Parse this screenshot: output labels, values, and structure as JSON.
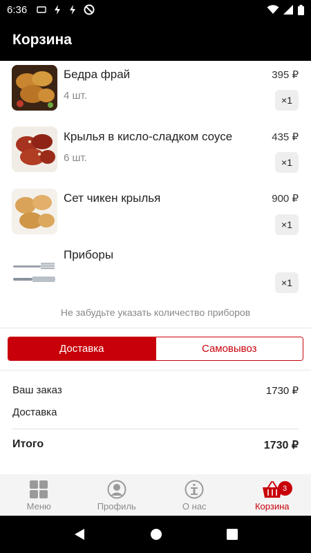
{
  "status_bar": {
    "time": "6:36",
    "notif_icons": [
      "app-icon",
      "bolt-icon",
      "bolt-icon",
      "no-disturb-icon"
    ],
    "right_icons": [
      "wifi-icon",
      "signal-icon",
      "battery-icon"
    ]
  },
  "header": {
    "title": "Корзина"
  },
  "cart": {
    "items": [
      {
        "name": "Бедра фрай",
        "qty": "4 шт.",
        "price": "395 ₽",
        "multiplier": "×1",
        "image": "fried-thighs-photo"
      },
      {
        "name": "Крылья в кисло-сладком соусе",
        "qty": "6 шт.",
        "price": "435 ₽",
        "multiplier": "×1",
        "image": "sweet-sour-wings-photo"
      },
      {
        "name": "Сет чикен крылья",
        "qty": "",
        "price": "900 ₽",
        "multiplier": "×1",
        "image": "chicken-wings-set-photo"
      },
      {
        "name": "Приборы",
        "qty": "",
        "price": "",
        "multiplier": "×1",
        "image": "cutlery-photo"
      }
    ],
    "reminder": "Не забудьте указать количество приборов"
  },
  "delivery_toggle": {
    "options": [
      "Доставка",
      "Самовывоз"
    ],
    "selected": "Доставка"
  },
  "summary": {
    "order_label": "Ваш заказ",
    "order_value": "1730 ₽",
    "delivery_label": "Доставка",
    "delivery_value": "",
    "total_label": "Итого",
    "total_value": "1730 ₽"
  },
  "bottom_nav": {
    "items": [
      {
        "label": "Меню",
        "icon": "grid-icon"
      },
      {
        "label": "Профиль",
        "icon": "profile-icon"
      },
      {
        "label": "О нас",
        "icon": "info-icon"
      },
      {
        "label": "Корзина",
        "icon": "basket-icon",
        "badge": "3",
        "active": true
      }
    ]
  },
  "colors": {
    "accent": "#c8000a",
    "header_bg": "#000000",
    "nav_bg": "#f4f4f4",
    "muted_text": "#888888"
  }
}
